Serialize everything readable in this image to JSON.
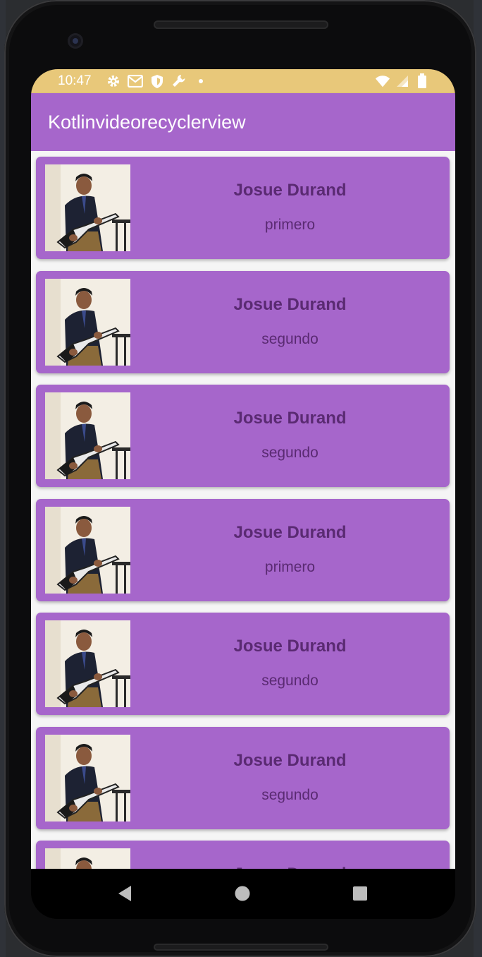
{
  "status_bar": {
    "time": "10:47",
    "background": "#e8c87a",
    "icons_left": [
      "settings-icon",
      "gmail-icon",
      "shield-icon",
      "wrench-icon",
      "notification-dot-icon"
    ],
    "icons_right": [
      "wifi-icon",
      "cell-signal-icon",
      "battery-icon"
    ]
  },
  "app_bar": {
    "title": "Kotlinvideorecyclerview",
    "color": "#a666cb"
  },
  "list": {
    "items": [
      {
        "name": "Josue Durand",
        "subtitle": "primero"
      },
      {
        "name": "Josue Durand",
        "subtitle": "segundo"
      },
      {
        "name": "Josue Durand",
        "subtitle": "segundo"
      },
      {
        "name": "Josue Durand",
        "subtitle": "primero"
      },
      {
        "name": "Josue Durand",
        "subtitle": "segundo"
      },
      {
        "name": "Josue Durand",
        "subtitle": "segundo"
      },
      {
        "name": "Josue Durand",
        "subtitle": ""
      }
    ]
  },
  "nav_bar": {
    "buttons": [
      "back-icon",
      "home-icon",
      "recents-icon"
    ]
  }
}
